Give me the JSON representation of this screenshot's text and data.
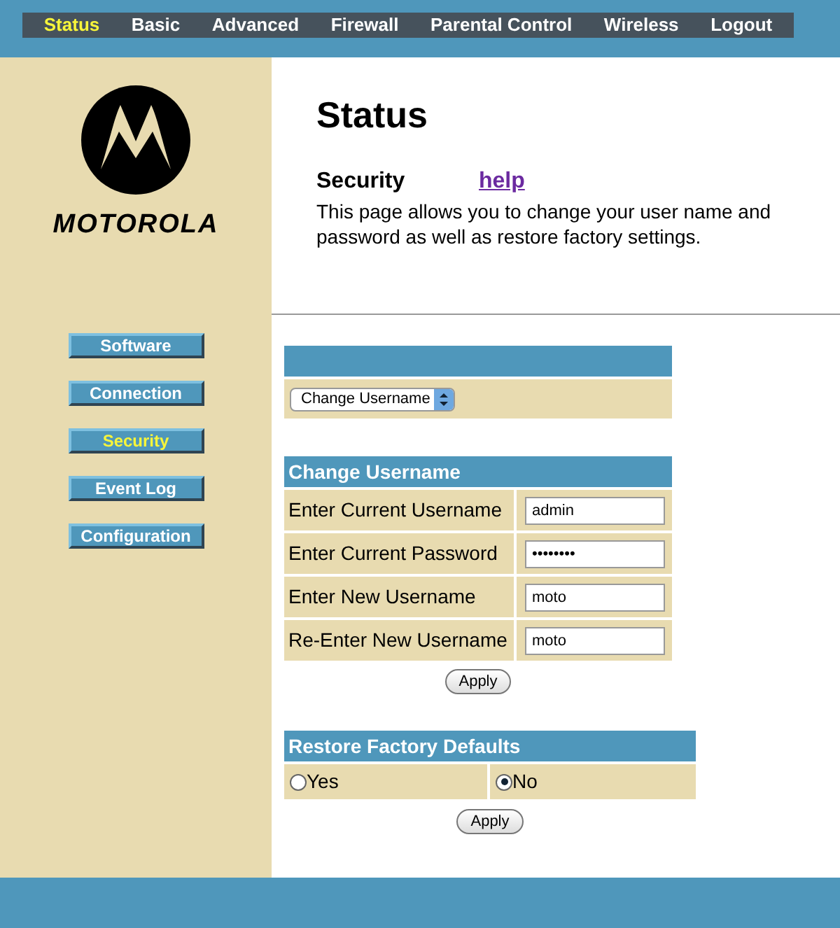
{
  "top_nav": [
    {
      "label": "Status",
      "selected": true
    },
    {
      "label": "Basic",
      "selected": false
    },
    {
      "label": "Advanced",
      "selected": false
    },
    {
      "label": "Firewall",
      "selected": false
    },
    {
      "label": "Parental Control",
      "selected": false
    },
    {
      "label": "Wireless",
      "selected": false
    },
    {
      "label": "Logout",
      "selected": false
    }
  ],
  "logo": {
    "wordmark": "MOTOROLA"
  },
  "sidebar": {
    "items": [
      {
        "label": "Software",
        "selected": false
      },
      {
        "label": "Connection",
        "selected": false
      },
      {
        "label": "Security",
        "selected": true
      },
      {
        "label": "Event Log",
        "selected": false
      },
      {
        "label": "Configuration",
        "selected": false
      }
    ]
  },
  "page": {
    "title": "Status",
    "section": "Security",
    "help_link": "help",
    "description": "This page allows you to change your user name and password as well as restore factory settings."
  },
  "mode_select": {
    "value": "Change Username"
  },
  "change_username": {
    "title": "Change Username",
    "fields": [
      {
        "label": "Enter Current Username",
        "value": "admin"
      },
      {
        "label": "Enter Current Password",
        "value": "••••••••"
      },
      {
        "label": "Enter New Username",
        "value": "moto"
      },
      {
        "label": "Re-Enter New Username",
        "value": "moto"
      }
    ],
    "button": "Apply"
  },
  "restore_defaults": {
    "title": "Restore Factory Defaults",
    "options": [
      {
        "label": "Yes",
        "selected": false
      },
      {
        "label": "No",
        "selected": true
      }
    ],
    "button": "Apply"
  }
}
